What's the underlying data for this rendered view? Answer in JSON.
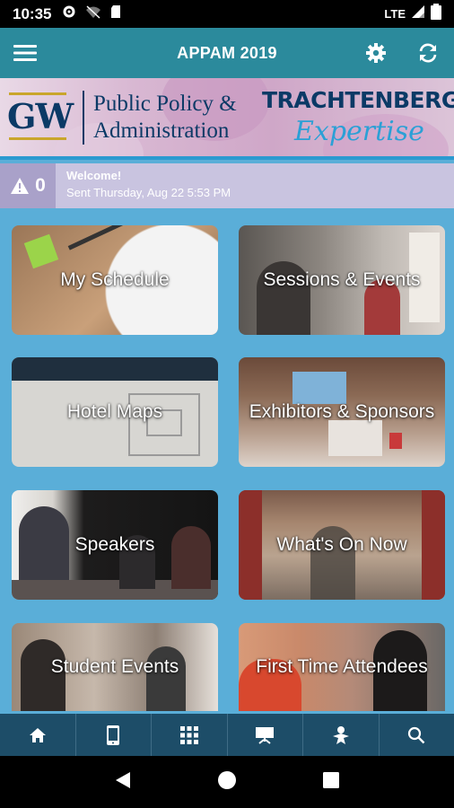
{
  "status_bar": {
    "time": "10:35",
    "network": "LTE"
  },
  "app_bar": {
    "title": "APPAM 2019"
  },
  "banner": {
    "logo": "GW",
    "line1": "Public Policy &",
    "line2": "Administration",
    "sponsor": "TRACHTENBERG",
    "sponsor_sub": "Expertise"
  },
  "notification": {
    "count": "0",
    "title": "Welcome!",
    "sent": "Sent Thursday, Aug 22 5:53 PM"
  },
  "tiles": [
    {
      "label": "My Schedule"
    },
    {
      "label": "Sessions & Events"
    },
    {
      "label": "Hotel Maps"
    },
    {
      "label": "Exhibitors & Sponsors"
    },
    {
      "label": "Speakers"
    },
    {
      "label": "What's On Now"
    },
    {
      "label": "Student Events"
    },
    {
      "label": "First Time Attendees"
    }
  ],
  "bottom_nav": [
    "home-icon",
    "mobile-icon",
    "grid-icon",
    "presentation-icon",
    "person-icon",
    "search-icon"
  ],
  "colors": {
    "app_bar": "#2b8a9c",
    "background": "#5aaed8",
    "bottom_nav": "#1d4d68",
    "notice": "#c9c4e0"
  }
}
